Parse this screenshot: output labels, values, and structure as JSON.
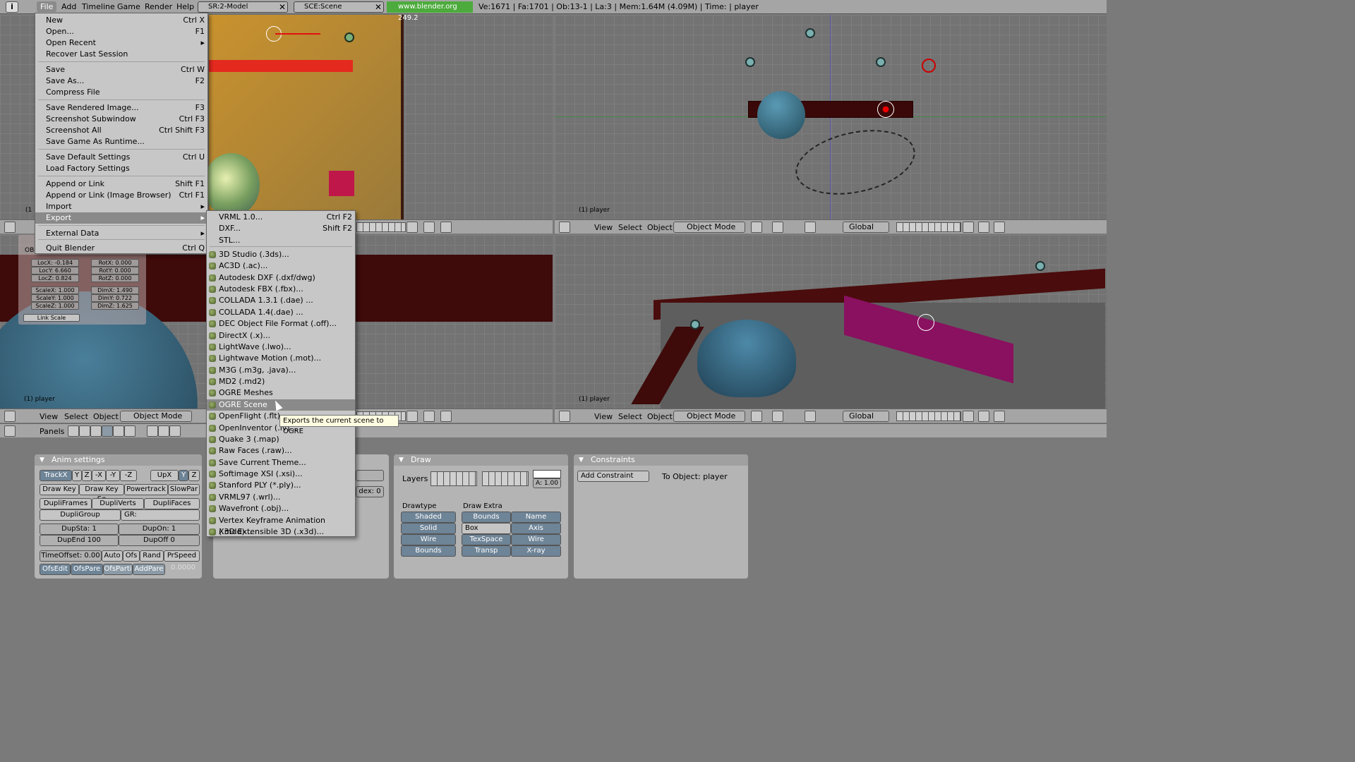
{
  "topbar": {
    "menus": [
      "File",
      "Add",
      "Timeline",
      "Game",
      "Render",
      "Help"
    ],
    "screen_field": "SR:2-Model",
    "scene_field": "SCE:Scene",
    "url": "www.blender.org 249.2",
    "stats": "Ve:1671 | Fa:1701 | Ob:13-1 | La:3  | Mem:1.64M (4.09M)  | Time: | player"
  },
  "file_menu": {
    "items": [
      {
        "label": "New",
        "shortcut": "Ctrl X"
      },
      {
        "label": "Open...",
        "shortcut": "F1"
      },
      {
        "label": "Open Recent",
        "shortcut": "▸"
      },
      {
        "label": "Recover Last Session",
        "shortcut": ""
      },
      {
        "label": "Save",
        "shortcut": "Ctrl W"
      },
      {
        "label": "Save As...",
        "shortcut": "F2"
      },
      {
        "label": "Compress File",
        "shortcut": ""
      },
      {
        "label": "Save Rendered Image...",
        "shortcut": "F3"
      },
      {
        "label": "Screenshot Subwindow",
        "shortcut": "Ctrl F3"
      },
      {
        "label": "Screenshot All",
        "shortcut": "Ctrl Shift F3"
      },
      {
        "label": "Save Game As Runtime...",
        "shortcut": ""
      },
      {
        "label": "Save Default Settings",
        "shortcut": "Ctrl U"
      },
      {
        "label": "Load Factory Settings",
        "shortcut": ""
      },
      {
        "label": "Append or Link",
        "shortcut": "Shift F1"
      },
      {
        "label": "Append or Link (Image Browser)",
        "shortcut": "Ctrl F1"
      },
      {
        "label": "Import",
        "shortcut": "▸"
      },
      {
        "label": "Export",
        "shortcut": "▸"
      },
      {
        "label": "External Data",
        "shortcut": "▸"
      },
      {
        "label": "Quit Blender",
        "shortcut": "Ctrl Q"
      }
    ]
  },
  "export_menu": {
    "items": [
      {
        "label": "VRML 1.0...",
        "shortcut": "Ctrl F2"
      },
      {
        "label": "DXF...",
        "shortcut": "Shift F2"
      },
      {
        "label": "STL...",
        "shortcut": ""
      },
      {
        "label": "3D Studio (.3ds)...",
        "shortcut": ""
      },
      {
        "label": "AC3D (.ac)...",
        "shortcut": ""
      },
      {
        "label": "Autodesk DXF (.dxf/dwg)",
        "shortcut": ""
      },
      {
        "label": "Autodesk FBX (.fbx)...",
        "shortcut": ""
      },
      {
        "label": "COLLADA 1.3.1 (.dae) ...",
        "shortcut": ""
      },
      {
        "label": "COLLADA 1.4(.dae) ...",
        "shortcut": ""
      },
      {
        "label": "DEC Object File Format (.off)...",
        "shortcut": ""
      },
      {
        "label": "DirectX (.x)...",
        "shortcut": ""
      },
      {
        "label": "LightWave (.lwo)...",
        "shortcut": ""
      },
      {
        "label": "Lightwave Motion (.mot)...",
        "shortcut": ""
      },
      {
        "label": "M3G (.m3g, .java)...",
        "shortcut": ""
      },
      {
        "label": "MD2 (.md2)",
        "shortcut": ""
      },
      {
        "label": "OGRE Meshes",
        "shortcut": ""
      },
      {
        "label": "OGRE Scene",
        "shortcut": ""
      },
      {
        "label": "OpenFlight (.flt)...",
        "shortcut": ""
      },
      {
        "label": "OpenInventor (.iv)...",
        "shortcut": ""
      },
      {
        "label": "Quake 3 (.map)",
        "shortcut": ""
      },
      {
        "label": "Raw Faces (.raw)...",
        "shortcut": ""
      },
      {
        "label": "Save Current Theme...",
        "shortcut": ""
      },
      {
        "label": "Softimage XSI (.xsi)...",
        "shortcut": ""
      },
      {
        "label": "Stanford PLY (*.ply)...",
        "shortcut": ""
      },
      {
        "label": "VRML97 (.wrl)...",
        "shortcut": ""
      },
      {
        "label": "Wavefront (.obj)...",
        "shortcut": ""
      },
      {
        "label": "Vertex Keyframe Animation (.mdd)...",
        "shortcut": ""
      },
      {
        "label": "X3D Extensible 3D (.x3d)...",
        "shortcut": ""
      }
    ],
    "tooltip": "Exports the current scene to OGRE"
  },
  "viewports": {
    "label_player": "(1) player",
    "label_1": "(1",
    "view": "View",
    "select": "Select",
    "object": "Object",
    "mode": "Object Mode",
    "orient": "Global"
  },
  "transform": {
    "ob": "OB:",
    "locx": "LocX: -0.184",
    "locy": "LocY: 6.660",
    "locz": "LocZ: 0.824",
    "rotx": "RotX: 0.000",
    "roty": "RotY: 0.000",
    "rotz": "RotZ: 0.000",
    "scalex": "ScaleX: 1.000",
    "scaley": "ScaleY: 1.000",
    "scalez": "ScaleZ: 1.000",
    "dimx": "DimX: 1.490",
    "dimy": "DimY: 0.722",
    "dimz": "DimZ: 1.625",
    "linkscale": "Link Scale"
  },
  "buttons": {
    "panels_label": "Panels",
    "anim": {
      "title": "Anim settings",
      "trackx": "TrackX",
      "y": "Y",
      "z": "Z",
      "mx": "-X",
      "my": "-Y",
      "mz": "-Z",
      "upx": "UpX",
      "upy": "Y",
      "upz": "Z",
      "drawkey": "Draw Key",
      "drawkeyse": "Draw Key Se",
      "powertrack": "Powertrack",
      "slowpar": "SlowPar",
      "dupliframes": "DupliFrames",
      "dupliverts": "DupliVerts",
      "duplifaces": "DupliFaces",
      "dupligroup": "DupliGroup",
      "gr": "GR:",
      "dupsta": "DupSta: 1",
      "dupon": "DupOn: 1",
      "dupend": "DupEnd 100",
      "dupoff": "DupOff 0",
      "timeoffset": "TimeOffset: 0.00",
      "auto": "Auto",
      "ofs": "Ofs",
      "rand": "Rand",
      "prspeed": "PrSpeed",
      "ofsedit": "OfsEdit",
      "ofspare": "OfsPare",
      "ofsparti": "OfsParti",
      "addpare": "AddPare",
      "val": "0.0000"
    },
    "mid": {
      "dex": "dex: 0"
    },
    "draw": {
      "title": "Draw",
      "layers": "Layers",
      "alpha": "A: 1.00",
      "drawtype": "Drawtype",
      "drawextra": "Draw Extra",
      "shaded": "Shaded",
      "solid": "Solid",
      "wire": "Wire",
      "bounds": "Bounds",
      "eb_bounds": "Bounds",
      "eb_name": "Name",
      "eb_box": "Box",
      "eb_axis": "Axis",
      "eb_texspace": "TexSpace",
      "eb_wire": "Wire",
      "eb_transp": "Transp",
      "eb_xray": "X-ray"
    },
    "constraints": {
      "title": "Constraints",
      "add": "Add Constraint",
      "to": "To Object: player"
    }
  }
}
